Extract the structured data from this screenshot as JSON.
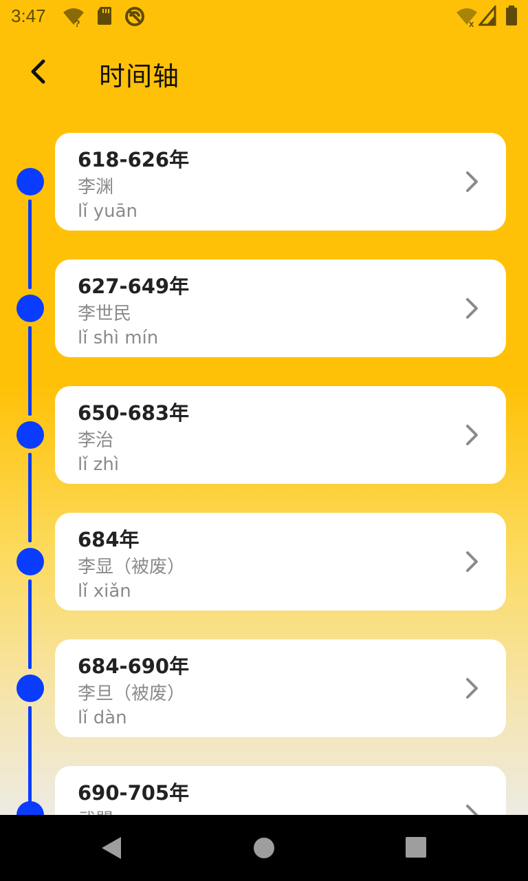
{
  "status_bar": {
    "time": "3:47",
    "icons": [
      "wifi-question-icon",
      "sd-card-icon",
      "do-not-disturb-icon",
      "wifi-off-icon",
      "signal-icon",
      "battery-icon"
    ]
  },
  "header": {
    "title": "时间轴",
    "back_icon": "chevron-left-icon"
  },
  "colors": {
    "background_top": "#FFC107",
    "background_bottom": "#EDEBE3",
    "timeline_accent": "#0A3CFF",
    "card_background": "#FFFFFF",
    "period_text": "#222222",
    "secondary_text": "#8A8A8A"
  },
  "timeline": {
    "items": [
      {
        "period": "618-626年",
        "name": "李渊",
        "pinyin": "lǐ yuān"
      },
      {
        "period": "627-649年",
        "name": "李世民",
        "pinyin": "lǐ shì mín"
      },
      {
        "period": "650-683年",
        "name": "李治",
        "pinyin": "lǐ zhì"
      },
      {
        "period": "684年",
        "name": "李显（被废）",
        "pinyin": "lǐ xiǎn"
      },
      {
        "period": "684-690年",
        "name": "李旦（被废）",
        "pinyin": "lǐ dàn"
      },
      {
        "period": "690-705年",
        "name": "武曌",
        "pinyin": ""
      }
    ]
  },
  "nav_bar": {
    "buttons": [
      "back-triangle-icon",
      "home-circle-icon",
      "recents-square-icon"
    ]
  }
}
